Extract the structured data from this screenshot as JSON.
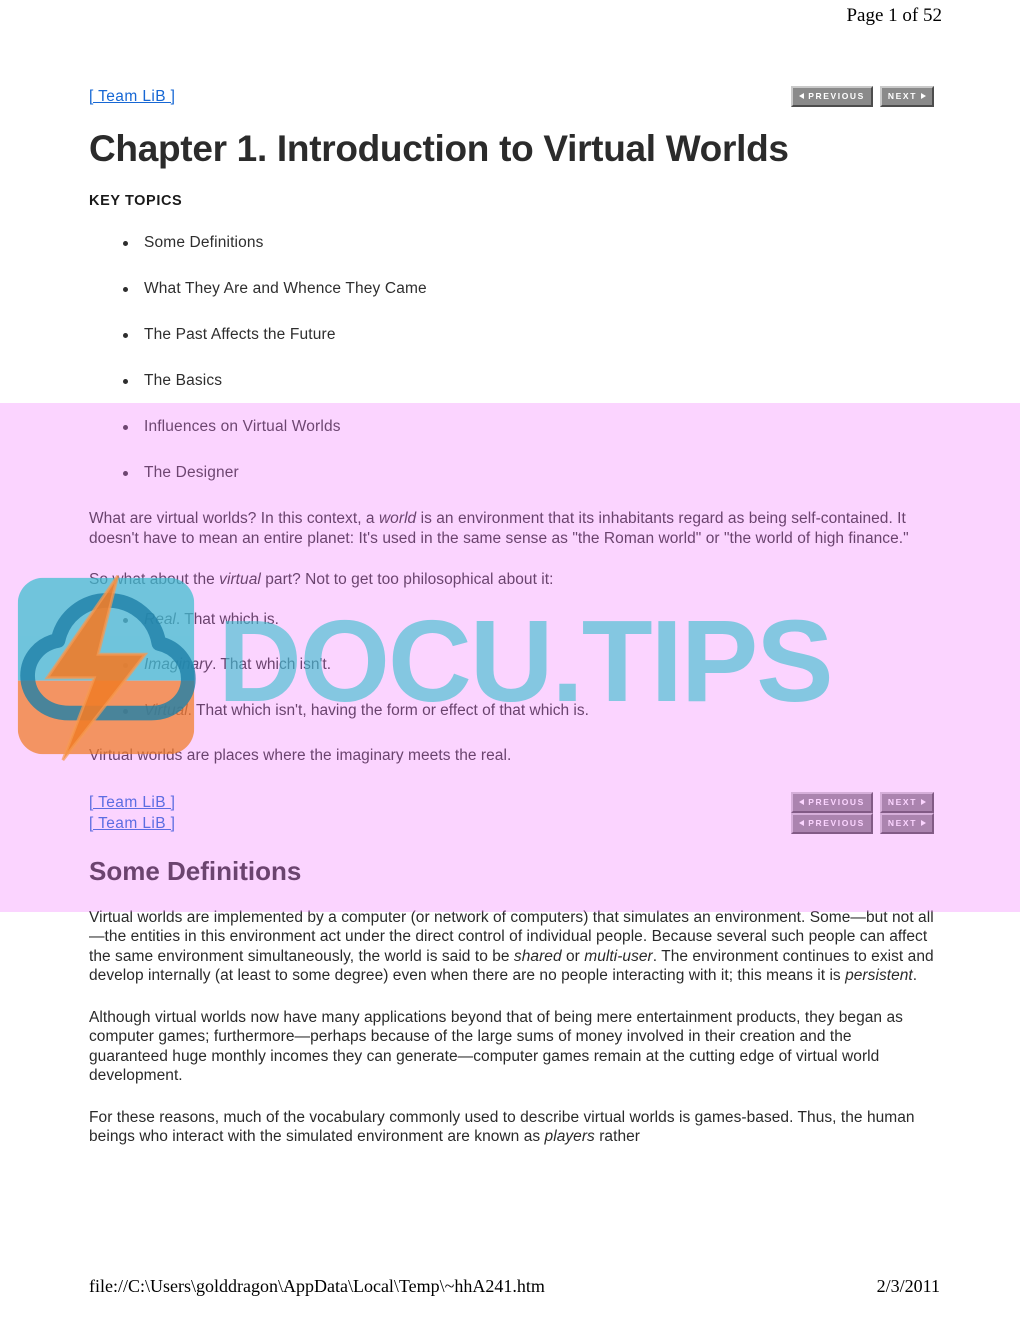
{
  "print": {
    "header_page": "Page 1 of 52",
    "footer_path": "file://C:\\Users\\golddragon\\AppData\\Local\\Temp\\~hhA241.htm",
    "footer_date": "2/3/2011"
  },
  "nav": {
    "teamlib_label": "[ Team LiB ]",
    "previous_label": "PREVIOUS",
    "next_label": "NEXT"
  },
  "chapter": {
    "title": "Chapter 1. Introduction to Virtual Worlds",
    "key_topics_label": "KEY TOPICS",
    "topics": [
      {
        "label": "Some Definitions"
      },
      {
        "label": "What They Are and Whence They Came"
      },
      {
        "label": "The Past Affects the Future"
      },
      {
        "label": "The Basics"
      },
      {
        "label": "Influences on Virtual Worlds"
      },
      {
        "label": "The Designer"
      }
    ]
  },
  "intro": {
    "para1_a": "What are virtual worlds? In this context, a ",
    "para1_em": "world",
    "para1_b": " is an environment that its inhabitants regard as being self-contained. It doesn't have to mean an entire planet: It's used in the same sense as \"the Roman world\" or \"the world of high finance.\"",
    "para2_a": "So what about the ",
    "para2_em": "virtual",
    "para2_b": " part? Not to get too philosophical about it:",
    "definitions": [
      {
        "term": "Real",
        "text": ". That which is."
      },
      {
        "term": "Imaginary",
        "text": ". That which isn't."
      },
      {
        "term": "Virtual",
        "text": ". That which isn't, having the form or effect of that which is."
      }
    ],
    "closing": "Virtual worlds are places where the imaginary meets the real."
  },
  "some_definitions": {
    "heading": "Some Definitions",
    "para1_a": "Virtual worlds are implemented by a computer (or network of computers) that simulates an environment. Some—but not all—the entities in this environment act under the direct control of individual people. Because several such people can affect the same environment simultaneously, the world is said to be ",
    "para1_em1": "shared",
    "para1_mid": " or ",
    "para1_em2": "multi-user",
    "para1_b": ". The environment continues to exist and develop internally (at least to some degree) even when there are no people interacting with it; this means it is ",
    "para1_em3": "persistent",
    "para1_end": ".",
    "para2": "Although virtual worlds now have many applications beyond that of being mere entertainment products, they began as computer games; furthermore—perhaps because of the large sums of money involved in their creation and the guaranteed huge monthly incomes they can generate—computer games remain at the cutting edge of virtual world development.",
    "para3_a": "For these reasons, much of the vocabulary commonly used to describe virtual worlds is games-based. Thus, the human beings who interact with the simulated environment are known as ",
    "para3_em": "players",
    "para3_b": " rather"
  },
  "watermark": {
    "text": "DOCU.TIPS",
    "logo_name": "cloud-lightning-logo",
    "teal": "#3ABECF",
    "orange": "#F07C28",
    "deep_teal": "#1E7FA8",
    "overlay_color": "#F3B3FA"
  }
}
